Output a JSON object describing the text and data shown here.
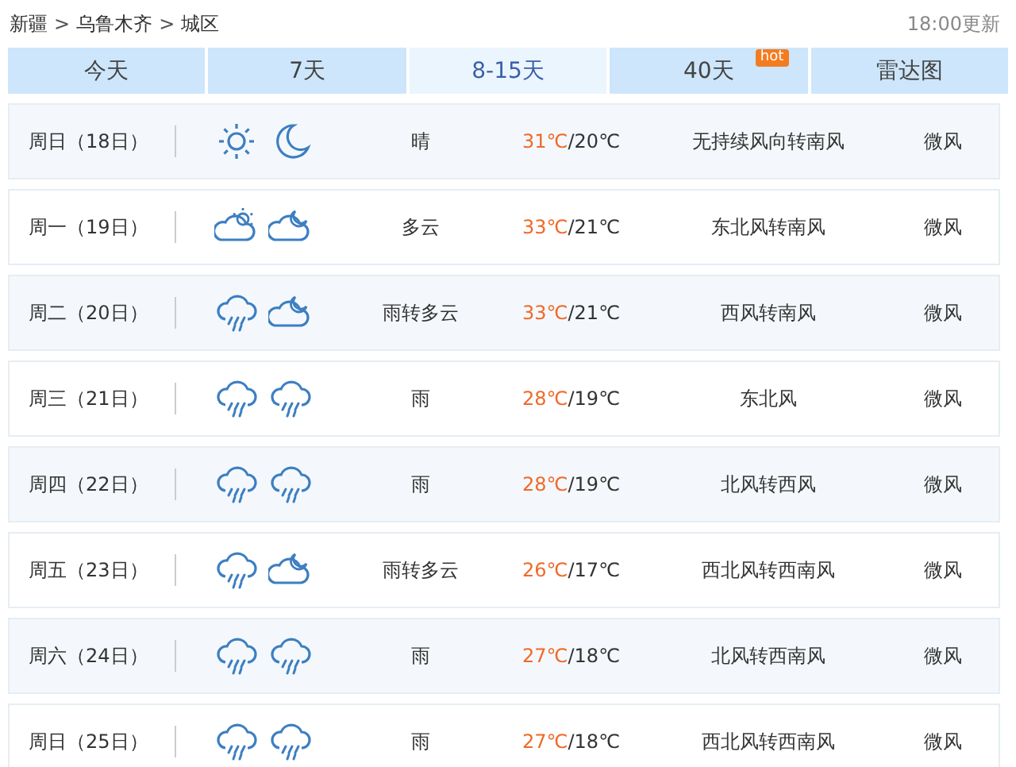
{
  "breadcrumb": [
    {
      "label": "新疆"
    },
    {
      "label": "乌鲁木齐"
    },
    {
      "label": "城区"
    }
  ],
  "breadcrumb_separator": ">",
  "updated": "18:00更新",
  "tabs": [
    {
      "label": "今天",
      "selected": false
    },
    {
      "label": "7天",
      "selected": false
    },
    {
      "label": "8-15天",
      "selected": true
    },
    {
      "label": "40天",
      "selected": false,
      "badge": "hot"
    },
    {
      "label": "雷达图",
      "selected": false
    }
  ],
  "days": [
    {
      "date": "周日（18日）",
      "icons": [
        {
          "kind": "sun"
        },
        {
          "kind": "moon"
        }
      ],
      "weather": "晴",
      "high": "31℃",
      "low": "/20℃",
      "wind": "无持续风向转南风",
      "wind_level": "微风"
    },
    {
      "date": "周一（19日）",
      "icons": [
        {
          "kind": "cloudsun"
        },
        {
          "kind": "cloudmoon"
        }
      ],
      "weather": "多云",
      "high": "33℃",
      "low": "/21℃",
      "wind": "东北风转南风",
      "wind_level": "微风"
    },
    {
      "date": "周二（20日）",
      "icons": [
        {
          "kind": "rain"
        },
        {
          "kind": "cloudmoon"
        }
      ],
      "weather": "雨转多云",
      "high": "33℃",
      "low": "/21℃",
      "wind": "西风转南风",
      "wind_level": "微风"
    },
    {
      "date": "周三（21日）",
      "icons": [
        {
          "kind": "rain"
        },
        {
          "kind": "rain"
        }
      ],
      "weather": "雨",
      "high": "28℃",
      "low": "/19℃",
      "wind": "东北风",
      "wind_level": "微风"
    },
    {
      "date": "周四（22日）",
      "icons": [
        {
          "kind": "rain"
        },
        {
          "kind": "rain"
        }
      ],
      "weather": "雨",
      "high": "28℃",
      "low": "/19℃",
      "wind": "北风转西风",
      "wind_level": "微风"
    },
    {
      "date": "周五（23日）",
      "icons": [
        {
          "kind": "rain"
        },
        {
          "kind": "cloudmoon"
        }
      ],
      "weather": "雨转多云",
      "high": "26℃",
      "low": "/17℃",
      "wind": "西北风转西南风",
      "wind_level": "微风"
    },
    {
      "date": "周六（24日）",
      "icons": [
        {
          "kind": "rain"
        },
        {
          "kind": "rain"
        }
      ],
      "weather": "雨",
      "high": "27℃",
      "low": "/18℃",
      "wind": "北风转西南风",
      "wind_level": "微风"
    },
    {
      "date": "周日（25日）",
      "icons": [
        {
          "kind": "rain"
        },
        {
          "kind": "rain"
        }
      ],
      "weather": "雨",
      "high": "27℃",
      "low": "/18℃",
      "wind": "西北风转西南风",
      "wind_level": "微风"
    }
  ]
}
